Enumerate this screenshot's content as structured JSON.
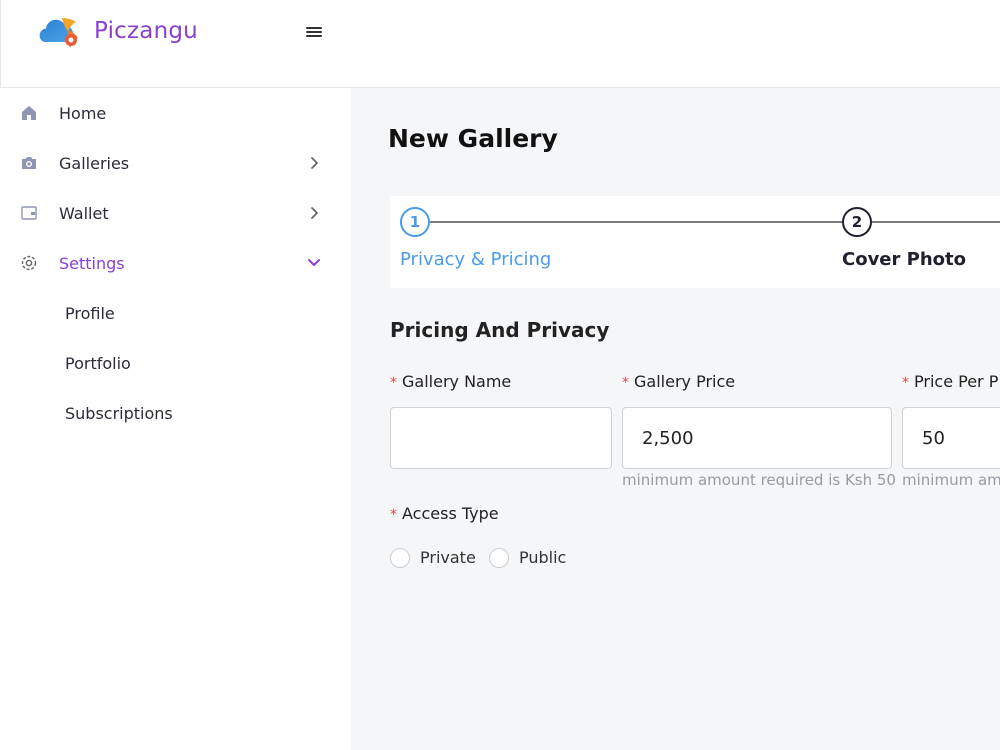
{
  "brand": {
    "name": "Piczangu"
  },
  "sidebar": {
    "items": [
      {
        "label": "Home",
        "icon": "home-icon"
      },
      {
        "label": "Galleries",
        "icon": "camera-icon"
      },
      {
        "label": "Wallet",
        "icon": "wallet-icon"
      },
      {
        "label": "Settings",
        "icon": "gear-icon",
        "active": true
      }
    ],
    "sub_items": [
      {
        "label": "Profile"
      },
      {
        "label": "Portfolio"
      },
      {
        "label": "Subscriptions"
      }
    ]
  },
  "page": {
    "title": "New Gallery"
  },
  "steps": [
    {
      "number": "1",
      "label": "Privacy & Pricing",
      "active": true
    },
    {
      "number": "2",
      "label": "Cover Photo"
    }
  ],
  "form": {
    "section_title": "Pricing And Privacy",
    "required_mark": "*",
    "fields": {
      "gallery_name": {
        "label": "Gallery Name",
        "value": ""
      },
      "gallery_price": {
        "label": "Gallery Price",
        "value": "2,500",
        "hint": "minimum amount required is Ksh 50"
      },
      "price_per": {
        "label": "Price Per P",
        "value": "50",
        "hint": "minimum amo"
      }
    },
    "access_type": {
      "label": "Access Type",
      "options": [
        "Private",
        "Public"
      ]
    }
  },
  "colors": {
    "brand_purple": "#8a3fd1",
    "active_blue": "#4a9bea",
    "required_red": "#e04848"
  }
}
